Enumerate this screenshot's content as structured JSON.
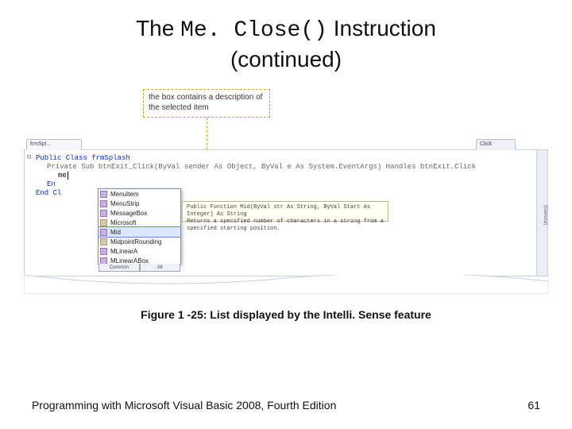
{
  "title": {
    "pre": "The ",
    "mono": "Me. Close()",
    "post": " Instruction",
    "line2": "(continued)"
  },
  "callout": "the box contains a description of the selected item",
  "editor": {
    "tab_left": "frmSpl...",
    "tab_right": "Click",
    "side_pane": "(General)",
    "line_class": "Public Class frmSplash",
    "line_sub": "Private Sub btnExit_Click(ByVal sender As Object, ByVal e As System.EventArgs) Handles btnExit.Click",
    "caret_text": "me",
    "line_end1": "En",
    "line_end2": "End Cl"
  },
  "intellisense": {
    "items": [
      "MenuItem",
      "MenuStrip",
      "MessageBox",
      "Microsoft",
      "Mid",
      "MidpointRounding",
      "MLinearA",
      "MLinearABox"
    ],
    "selected_index": 4,
    "tab_common": "Common",
    "tab_all": "All"
  },
  "tooltip": {
    "line1": "Public Function Mid(ByVal str As String, ByVal Start As Integer) As String",
    "line2": "Returns a specified number of characters in a string from a specified starting position."
  },
  "caption": "Figure 1 -25: List displayed by the Intelli. Sense feature",
  "footer": {
    "left": "Programming with Microsoft Visual Basic 2008, Fourth Edition",
    "right": "61"
  }
}
